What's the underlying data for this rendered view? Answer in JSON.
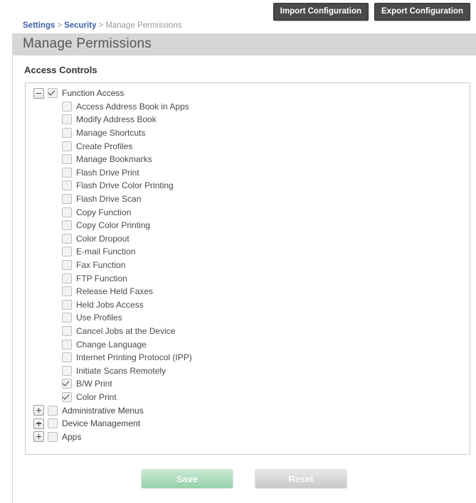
{
  "topbar": {
    "import_label": "Import Configuration",
    "export_label": "Export Configuration"
  },
  "breadcrumb": {
    "items": [
      {
        "label": "Settings",
        "link": true
      },
      {
        "label": "Security",
        "link": true
      },
      {
        "label": "Manage Permissions",
        "link": false
      }
    ],
    "separator": ">"
  },
  "page": {
    "title": "Manage Permissions",
    "section_heading": "Access Controls"
  },
  "tree": {
    "nodes": [
      {
        "label": "Function Access",
        "checked": true,
        "expander": "minus",
        "expanded": true,
        "children": [
          {
            "label": "Access Address Book in Apps",
            "checked": false
          },
          {
            "label": "Modify Address Book",
            "checked": false
          },
          {
            "label": "Manage Shortcuts",
            "checked": false
          },
          {
            "label": "Create Profiles",
            "checked": false
          },
          {
            "label": "Manage Bookmarks",
            "checked": false
          },
          {
            "label": "Flash Drive Print",
            "checked": false
          },
          {
            "label": "Flash Drive Color Printing",
            "checked": false
          },
          {
            "label": "Flash Drive Scan",
            "checked": false
          },
          {
            "label": "Copy Function",
            "checked": false
          },
          {
            "label": "Copy Color Printing",
            "checked": false
          },
          {
            "label": "Color Dropout",
            "checked": false
          },
          {
            "label": "E-mail Function",
            "checked": false
          },
          {
            "label": "Fax Function",
            "checked": false
          },
          {
            "label": "FTP Function",
            "checked": false
          },
          {
            "label": "Release Held Faxes",
            "checked": false
          },
          {
            "label": "Held Jobs Access",
            "checked": false
          },
          {
            "label": "Use Profiles",
            "checked": false
          },
          {
            "label": "Cancel Jobs at the Device",
            "checked": false
          },
          {
            "label": "Change Language",
            "checked": false
          },
          {
            "label": "Internet Printing Protocol (IPP)",
            "checked": false
          },
          {
            "label": "Initiate Scans Remotely",
            "checked": false
          },
          {
            "label": "B/W Print",
            "checked": true
          },
          {
            "label": "Color Print",
            "checked": true
          }
        ]
      },
      {
        "label": "Administrative Menus",
        "checked": false,
        "expander": "plus",
        "expanded": false,
        "children": []
      },
      {
        "label": "Device Management",
        "checked": false,
        "expander": "plus",
        "expanded": false,
        "children": []
      },
      {
        "label": "Apps",
        "checked": false,
        "expander": "plus",
        "expanded": false,
        "children": []
      }
    ]
  },
  "footer": {
    "save_label": "Save",
    "reset_label": "Reset"
  },
  "colors": {
    "breadcrumb_link": "#3a5fa8",
    "title_bar": "#d6d6d6",
    "topbutton_bg": "#4a4a4a",
    "save_bg": "#94d2ab",
    "reset_bg": "#c8c8c8"
  }
}
